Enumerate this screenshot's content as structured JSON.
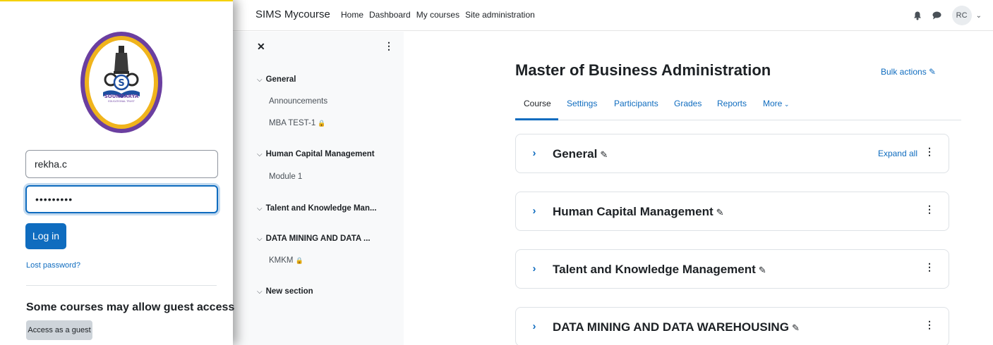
{
  "login": {
    "logo_text": "SOUNDARYA",
    "logo_subtext": "EDUCATIONAL TRUST",
    "username_value": "rekha.c",
    "password_value": "•••••••••",
    "login_label": "Log in",
    "lost_password": "Lost password?",
    "guest_heading": "Some courses may allow guest access",
    "guest_button": "Access as a guest"
  },
  "navbar": {
    "brand": "SIMS Mycourse",
    "links": [
      "Home",
      "Dashboard",
      "My courses",
      "Site administration"
    ],
    "avatar_initials": "RC",
    "icons": [
      "bell-icon",
      "chat-icon",
      "chevron-down-icon"
    ]
  },
  "course_index": {
    "close_glyph": "✕",
    "kebab_glyph": "⋮",
    "sections": [
      {
        "title": "General",
        "items": [
          "Announcements",
          "MBA TEST-1"
        ]
      },
      {
        "title": "Human Capital Management",
        "items": [
          "Module 1"
        ]
      },
      {
        "title": "Talent and Knowledge Man...",
        "items": []
      },
      {
        "title": "DATA MINING AND DATA ...",
        "items": [
          "KMKM"
        ]
      },
      {
        "title": "New section",
        "items": []
      }
    ]
  },
  "main": {
    "course_title": "Master of Business Administration",
    "bulk_actions": "Bulk actions",
    "tabs": [
      "Course",
      "Settings",
      "Participants",
      "Grades",
      "Reports",
      "More"
    ],
    "expand_all": "Expand all",
    "sections": [
      "General",
      "Human Capital Management",
      "Talent and Knowledge Management",
      "DATA MINING AND DATA WAREHOUSING"
    ]
  },
  "colors": {
    "accent": "#0f6cbf",
    "logo_ring": "#6b3fa0",
    "logo_gold": "#f0b41c"
  }
}
